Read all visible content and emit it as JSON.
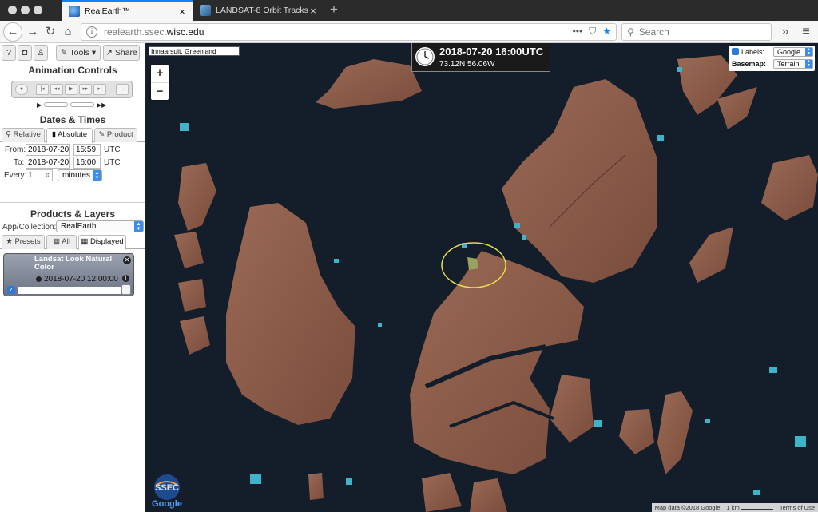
{
  "browser": {
    "tabs": [
      {
        "title": "RealEarth™",
        "close": "×"
      },
      {
        "title": "LANDSAT-8 Orbit Tracks",
        "close": "×"
      }
    ],
    "new_tab": "+",
    "url_host_prefix": "realearth.ssec.",
    "url_host_main": "wisc.edu",
    "url_tools": "•••",
    "search_placeholder": "Search",
    "overflow": "»",
    "menu": "≡",
    "accent_color": "#0a84ff"
  },
  "sidebar": {
    "toolbar": {
      "help": "?",
      "camera": "◘",
      "user": "♙",
      "tools": "✎ Tools ▾",
      "share": "↗ Share"
    },
    "animation": {
      "title": "Animation Controls",
      "buttons": [
        "●",
        "|◂",
        "◂◂",
        "▶",
        "▸▸",
        "▸|",
        "→"
      ],
      "slow": "▶",
      "fast": "▶▶"
    },
    "dates": {
      "title": "Dates & Times",
      "tabs": [
        "⚲ Relative",
        "▮ Absolute",
        "✎ Product"
      ],
      "from_label": "From:",
      "from_date": "2018-07-20",
      "from_time": "15:59",
      "to_label": "To:",
      "to_date": "2018-07-20",
      "to_time": "16:00",
      "utc": "UTC",
      "every_label": "Every:",
      "every_value": "1",
      "every_stepper": "⇕",
      "every_unit": "minutes"
    },
    "products": {
      "title": "Products & Layers",
      "app_label": "App/Collection:",
      "app_value": "RealEarth",
      "tabs": [
        "★ Presets",
        "▦ All",
        "▦ Displayed"
      ],
      "layer": {
        "name": "Landsat Look Natural Color",
        "time": "2018-07-20 12:00:00",
        "close": "✕",
        "info": "i",
        "check": "✓"
      }
    }
  },
  "map": {
    "location": "Innaarsuit, Greenland",
    "zoom_in": "+",
    "zoom_out": "−",
    "datetime": "2018-07-20 16:00UTC",
    "coords": "73.12N 56.06W",
    "labels_label": "Labels:",
    "labels_value": "Google",
    "labels_check": "✓",
    "basemap_label": "Basemap:",
    "basemap_value": "Terrain",
    "logo_text_1": "SSEC",
    "logo_text_2": "Google",
    "attribution": [
      "Map data ©2018 Google",
      "1 km",
      "Terms of Use"
    ],
    "highlight_color": "#e8e04a",
    "land_color": "#8a5a48",
    "water_color": "#141d2a",
    "ice_color": "#3fb3c9"
  }
}
